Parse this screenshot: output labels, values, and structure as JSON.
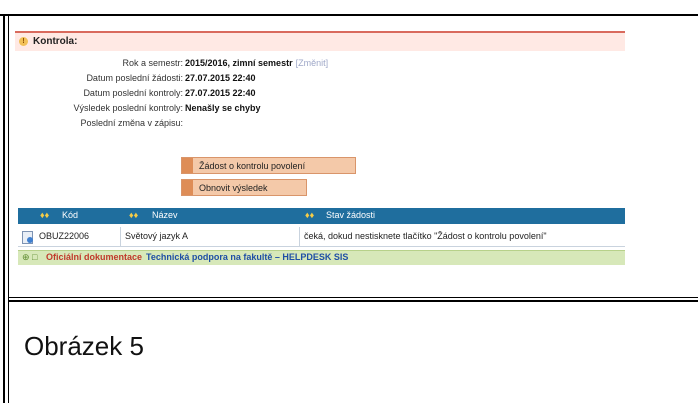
{
  "panel": {
    "header_title": "Kontrola:",
    "form": {
      "semester": {
        "label": "Rok a semestr:",
        "value": "2015/2016, zimní semestr",
        "link": "[Změnit]"
      },
      "last_request": {
        "label": "Datum poslední žádosti:",
        "value": "27.07.2015 22:40"
      },
      "last_check": {
        "label": "Datum poslední kontroly:",
        "value": "27.07.2015 22:40"
      },
      "result": {
        "label": "Výsledek poslední kontroly:",
        "value": "Nenašly se chyby"
      },
      "last_change": {
        "label": "Poslední změna v zápisu:",
        "value": ""
      }
    },
    "buttons": {
      "request_check": "Žádost o kontrolu povolení",
      "refresh_result": "Obnovit výsledek"
    },
    "table": {
      "headers": {
        "arrows": "♦♦",
        "code": "Kód",
        "name": "Název",
        "status": "Stav žádosti"
      },
      "rows": [
        {
          "code": "OBUZ22006",
          "name": "Světový jazyk A",
          "status": "čeká, dokud nestisknete tlačítko \"Žádost o kontrolu povolení\""
        }
      ]
    },
    "footer": {
      "icons": "⊕ □",
      "official_docs": "Oficiální dokumentace",
      "support": "Technická podpora na fakultě – HELPDESK SIS"
    }
  },
  "caption": "Obrázek 5",
  "colors": {
    "header_bg": "#ffe9e4",
    "table_header_bg": "#1f6e9e",
    "button_bg": "#f4c9a9",
    "footer_bg": "#d7e8b9"
  }
}
